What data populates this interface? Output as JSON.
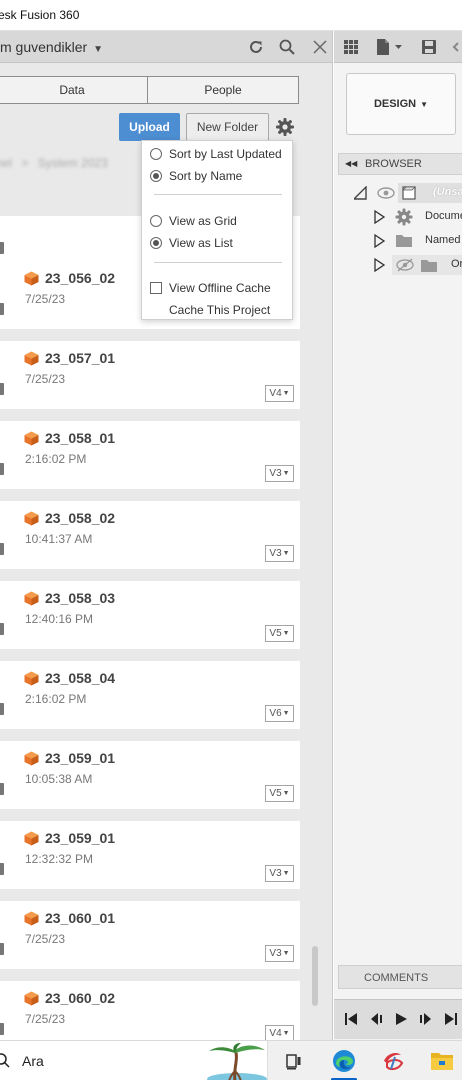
{
  "window": {
    "title": "esk Fusion 360"
  },
  "data_panel": {
    "project_name": "m guvendikler",
    "tabs": [
      {
        "label": "Data"
      },
      {
        "label": "People"
      }
    ],
    "upload_label": "Upload",
    "new_folder_label": "New Folder",
    "breadcrumb_blurred": [
      "nel",
      "System 2023"
    ],
    "files": [
      {
        "name": "23_056_02",
        "date": "7/25/23",
        "version": ""
      },
      {
        "name": "23_057_01",
        "date": "7/25/23",
        "version": "V4"
      },
      {
        "name": "23_058_01",
        "date": "2:16:02 PM",
        "version": "V3"
      },
      {
        "name": "23_058_02",
        "date": "10:41:37 AM",
        "version": "V3"
      },
      {
        "name": "23_058_03",
        "date": "12:40:16 PM",
        "version": "V5"
      },
      {
        "name": "23_058_04",
        "date": "2:16:02 PM",
        "version": "V6"
      },
      {
        "name": "23_059_01",
        "date": "10:05:38 AM",
        "version": "V5"
      },
      {
        "name": "23_059_01",
        "date": "12:32:32 PM",
        "version": "V3"
      },
      {
        "name": "23_060_01",
        "date": "7/25/23",
        "version": "V3"
      },
      {
        "name": "23_060_02",
        "date": "7/25/23",
        "version": "V4"
      }
    ]
  },
  "settings_menu": {
    "sort_by_last_updated": "Sort by Last Updated",
    "sort_by_name": "Sort by Name",
    "sort_selected": "name",
    "view_as_grid": "View as Grid",
    "view_as_list": "View as List",
    "view_selected": "list",
    "view_offline_cache": "View Offline Cache",
    "view_offline_cache_checked": false,
    "cache_this_project": "Cache This Project"
  },
  "design_panel": {
    "workspace_label": "DESIGN",
    "browser_label": "BROWSER",
    "browser_root_label": "(Unsa",
    "browser_items": [
      {
        "label": "Docume",
        "icon": "gear-icon"
      },
      {
        "label": "Named",
        "icon": "folder-icon"
      },
      {
        "label": "Or",
        "icon": "folder-icon"
      }
    ],
    "comments_label": "COMMENTS"
  },
  "taskbar": {
    "search_text": "Ara",
    "apps": [
      "task-view-icon",
      "edge-icon",
      "fusion-app-icon",
      "file-explorer-icon"
    ]
  },
  "colors": {
    "accent_blue": "#4d8ed2",
    "cube_orange": "#e8742a",
    "taskbar_active": "#0a64c8"
  }
}
